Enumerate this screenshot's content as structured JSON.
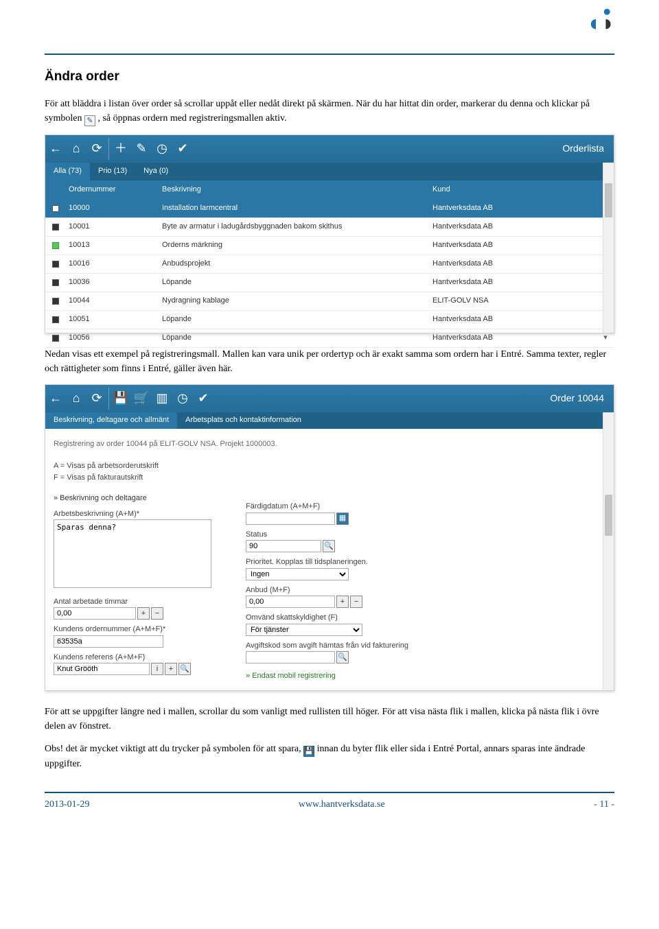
{
  "doc": {
    "heading": "Ändra order",
    "p1a": "För att bläddra i listan över order så scrollar uppåt eller nedåt direkt på skärmen. När du har hittat din order, markerar du denna och klickar på symbolen ",
    "p1b": ", så öppnas ordern med registreringsmallen aktiv.",
    "p2": "Nedan visas ett exempel på registreringsmall. Mallen kan vara unik per ordertyp och är exakt samma som ordern har i Entré. Samma texter, regler och rättigheter som finns i Entré, gäller även här.",
    "p3": "För att se uppgifter längre ned i mallen, scrollar du som vanligt med rullisten till höger. För att visa nästa flik i mallen, klicka på nästa flik i övre delen av fönstret.",
    "p4a": "Obs! det är mycket viktigt att du trycker på symbolen för att spara, ",
    "p4b": " innan du byter flik eller sida i Entré Portal, annars sparas inte ändrade uppgifter."
  },
  "orderlist": {
    "title": "Orderlista",
    "tabs": [
      "Alla (73)",
      "Prio (13)",
      "Nya (0)"
    ],
    "head": {
      "num": "Ordernummer",
      "desc": "Beskrivning",
      "cust": "Kund"
    },
    "rows": [
      {
        "sq": "white",
        "num": "10000",
        "desc": "Installation larmcentral",
        "cust": "Hantverksdata AB",
        "sel": true
      },
      {
        "sq": "black",
        "num": "10001",
        "desc": "Byte av armatur i ladugårdsbyggnaden bakom skithus",
        "cust": "Hantverksdata AB"
      },
      {
        "sq": "green",
        "num": "10013",
        "desc": "Orderns märkning",
        "cust": "Hantverksdata AB"
      },
      {
        "sq": "black",
        "num": "10016",
        "desc": "Anbudsprojekt",
        "cust": "Hantverksdata AB"
      },
      {
        "sq": "black",
        "num": "10036",
        "desc": "Löpande",
        "cust": "Hantverksdata AB"
      },
      {
        "sq": "black",
        "num": "10044",
        "desc": "Nydragning kablage",
        "cust": "ELIT-GOLV NSA"
      },
      {
        "sq": "black",
        "num": "10051",
        "desc": "Löpande",
        "cust": "Hantverksdata AB"
      },
      {
        "sq": "black",
        "num": "10056",
        "desc": "Löpande",
        "cust": "Hantverksdata AB"
      }
    ]
  },
  "form": {
    "title": "Order 10044",
    "tabs": [
      "Beskrivning, deltagare och allmänt",
      "Arbetsplats och kontaktinformation"
    ],
    "reg_line": "Registrering av order 10044 på ELIT-GOLV NSA. Projekt 1000003.",
    "legend1": "A = Visas på arbetsorderutskrift",
    "legend2": "F = Visas på fakturautskrift",
    "sec1": "» Beskrivning och deltagare",
    "lbl_arb": "Arbetsbeskrivning (A+M)*",
    "val_arb": "Sparas denna?",
    "lbl_tim": "Antal arbetade timmar",
    "val_tim": "0,00",
    "lbl_kord": "Kundens ordernummer (A+M+F)*",
    "val_kord": "63535a",
    "lbl_kref": "Kundens referens (A+M+F)",
    "val_kref": "Knut Grööth",
    "lbl_fdatum": "Färdigdatum (A+M+F)",
    "lbl_status": "Status",
    "val_status": "90",
    "lbl_prio": "Prioritet. Kopplas till tidsplaneringen.",
    "val_prio": "Ingen",
    "lbl_anbud": "Anbud (M+F)",
    "val_anbud": "0,00",
    "lbl_omv": "Omvänd skattskyldighet (F)",
    "val_omv": "För tjänster",
    "lbl_avg": "Avgiftskod som avgift hämtas från vid fakturering",
    "lbl_endast": "» Endast mobil registrering"
  },
  "footer": {
    "date": "2013-01-29",
    "url": "www.hantverksdata.se",
    "page": "- 11 -"
  }
}
